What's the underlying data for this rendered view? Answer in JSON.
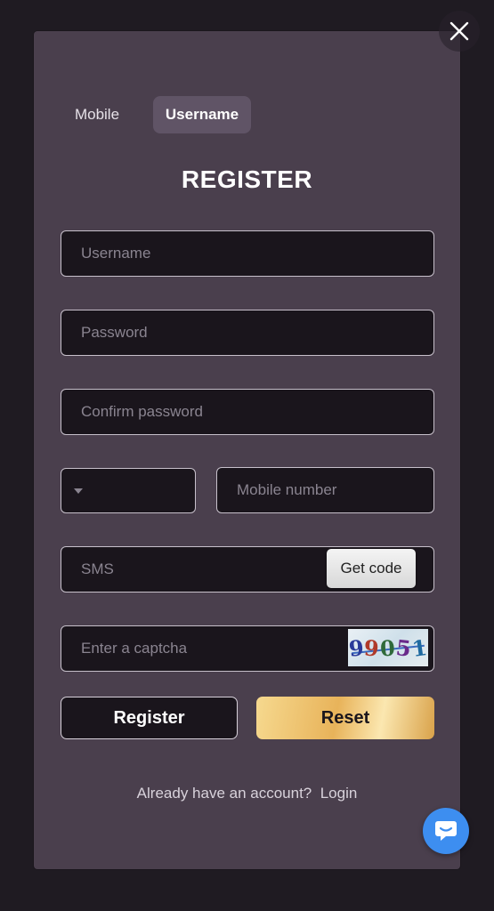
{
  "tabs": [
    {
      "label": "Mobile",
      "active": false
    },
    {
      "label": "Username",
      "active": true
    }
  ],
  "title": "REGISTER",
  "fields": {
    "username_placeholder": "Username",
    "password_placeholder": "Password",
    "confirm_placeholder": "Confirm password",
    "country_code_value": "",
    "mobile_placeholder": "Mobile number",
    "sms_placeholder": "SMS",
    "captcha_placeholder": "Enter a captcha"
  },
  "get_code_label": "Get code",
  "captcha_text": "99051",
  "buttons": {
    "register": "Register",
    "reset": "Reset"
  },
  "login_prompt": "Already have an account?",
  "login_link": "Login",
  "icons": {
    "close": "close-icon",
    "caret": "chevron-down-icon",
    "chat": "chat-bubble-icon"
  },
  "colors": {
    "background": "#1f1b22",
    "panel": "#4a3f4d",
    "active_tab": "#605466",
    "field_bg": "#1a151c",
    "reset_gold": "#e8b35a",
    "chat_blue": "#3d8ef0"
  }
}
